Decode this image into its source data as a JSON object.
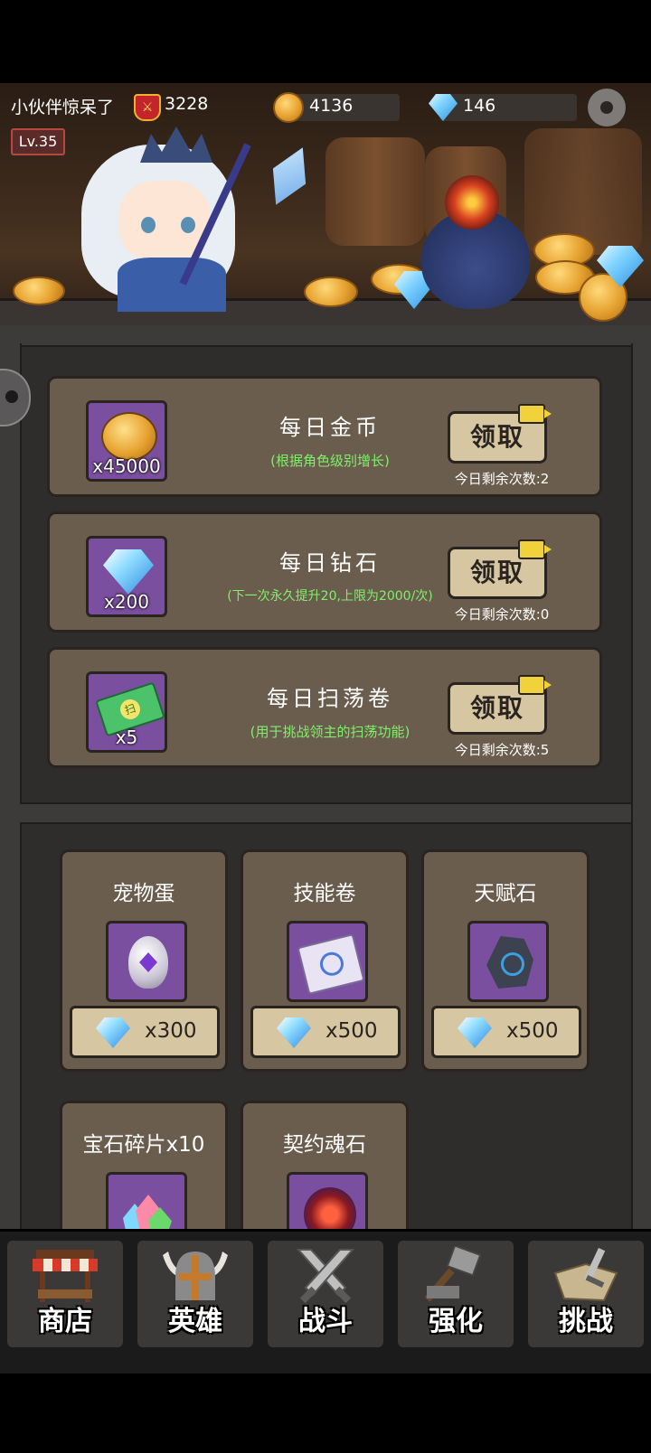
{
  "player": {
    "nickname": "小伙伴惊呆了",
    "power": "3228",
    "level": "Lv.35"
  },
  "resources": {
    "gold": "4136",
    "gems": "146"
  },
  "daily_rewards": [
    {
      "title": "每日金币",
      "subtitle": "(根据角色级别增长)",
      "quantity": "x45000",
      "icon": "gold-coin-icon",
      "button": "领取",
      "remaining": "今日剩余次数:2"
    },
    {
      "title": "每日钻石",
      "subtitle": "(下一次永久提升20,上限为2000/次)",
      "quantity": "x200",
      "icon": "diamond-icon",
      "button": "领取",
      "remaining": "今日剩余次数:0"
    },
    {
      "title": "每日扫荡卷",
      "subtitle": "(用于挑战领主的扫荡功能)",
      "quantity": "x5",
      "icon": "sweep-ticket-icon",
      "button": "领取",
      "remaining": "今日剩余次数:5"
    }
  ],
  "shop_items": [
    {
      "title": "宠物蛋",
      "price": "x300",
      "icon": "pet-egg-icon"
    },
    {
      "title": "技能卷",
      "price": "x500",
      "icon": "skill-scroll-icon"
    },
    {
      "title": "天赋石",
      "price": "x500",
      "icon": "talent-stone-icon"
    },
    {
      "title": "宝石碎片x10",
      "price": "",
      "icon": "gem-shard-icon"
    },
    {
      "title": "契约魂石",
      "price": "",
      "icon": "contract-soulstone-icon"
    }
  ],
  "nav": [
    {
      "label": "商店",
      "icon": "shop-stall-icon"
    },
    {
      "label": "英雄",
      "icon": "viking-helmet-icon"
    },
    {
      "label": "战斗",
      "icon": "crossed-swords-icon"
    },
    {
      "label": "强化",
      "icon": "hammer-icon"
    },
    {
      "label": "挑战",
      "icon": "map-sword-icon"
    }
  ],
  "colors": {
    "panel": "#6b5d4d",
    "slot": "#7b4fa0",
    "button": "#d6c6a2",
    "subtitle_green": "#7ff06a",
    "background": "#2f2d2c"
  }
}
